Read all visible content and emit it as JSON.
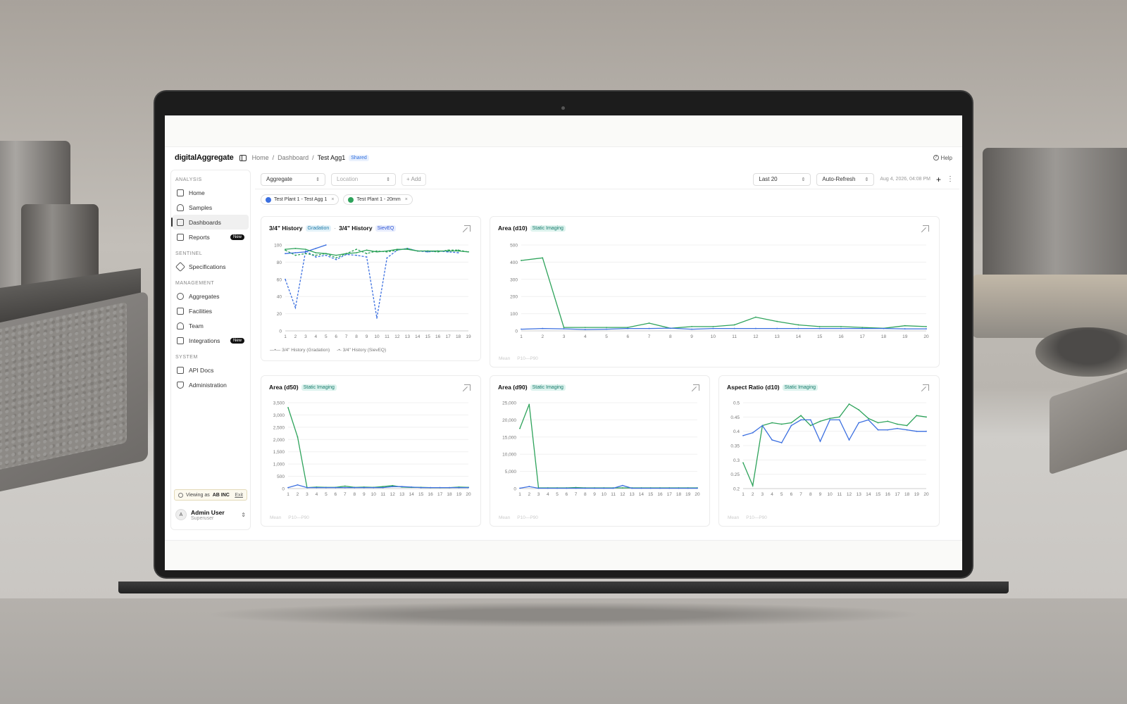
{
  "app": {
    "logo": "digitalAggregate",
    "breadcrumb": [
      "Home",
      "Dashboard",
      "Test Agg1"
    ],
    "shared_badge": "Shared",
    "help": "Help"
  },
  "sidebar": {
    "sections": [
      {
        "label": "ANALYSIS",
        "items": [
          {
            "label": "Home"
          },
          {
            "label": "Samples"
          },
          {
            "label": "Dashboards",
            "active": true
          },
          {
            "label": "Reports",
            "badge": "New"
          }
        ]
      },
      {
        "label": "SENTINEL",
        "items": [
          {
            "label": "Specifications"
          }
        ]
      },
      {
        "label": "MANAGEMENT",
        "items": [
          {
            "label": "Aggregates"
          },
          {
            "label": "Facilities"
          },
          {
            "label": "Team"
          },
          {
            "label": "Integrations",
            "badge": "New"
          }
        ]
      },
      {
        "label": "SYSTEM",
        "items": [
          {
            "label": "API Docs"
          },
          {
            "label": "Administration"
          }
        ]
      }
    ],
    "viewing": {
      "prefix": "Viewing as",
      "org": "AB INC",
      "exit": "Exit"
    },
    "user": {
      "initial": "A",
      "name": "Admin User",
      "role": "Superuser"
    }
  },
  "filters": {
    "aggregate": "Aggregate",
    "location_placeholder": "Location",
    "add": "+ Add",
    "range": "Last 20",
    "refresh": "Auto-Refresh",
    "timestamp": "Aug 4, 2026, 04:08 PM"
  },
  "chips": [
    {
      "label": "Test Plant 1 - Test Agg 1",
      "color": "#3b6fe0"
    },
    {
      "label": "Test Plant 1 - 20mm",
      "color": "#2ea35b"
    }
  ],
  "colors": {
    "blue": "#3b6fe0",
    "green": "#2ea35b"
  },
  "cards": {
    "history": {
      "title1": "3/4\" History",
      "tag1": "Gradation",
      "title2": "3/4\" History",
      "tag2": "SievEQ",
      "legend1": "3/4\" History (Gradation)",
      "legend2": "3/4\" History (SievEQ)"
    },
    "d10": {
      "title": "Area (d10)",
      "tag": "Static Imaging",
      "legend_mean": "Mean",
      "legend_band": "P10—P90"
    },
    "d50": {
      "title": "Area (d50)",
      "tag": "Static Imaging",
      "legend_mean": "Mean",
      "legend_band": "P10—P90"
    },
    "d90": {
      "title": "Area (d90)",
      "tag": "Static Imaging",
      "legend_mean": "Mean",
      "legend_band": "P10—P90"
    },
    "ar": {
      "title": "Aspect Ratio (d10)",
      "tag": "Static Imaging",
      "legend_mean": "Mean",
      "legend_band": "P10—P90"
    }
  },
  "chart_data": [
    {
      "id": "history",
      "type": "line",
      "x": [
        1,
        2,
        3,
        4,
        5,
        6,
        7,
        8,
        9,
        10,
        11,
        12,
        13,
        14,
        15,
        16,
        17,
        18,
        19
      ],
      "ylim": [
        0,
        100
      ],
      "yticks": [
        0,
        20,
        40,
        60,
        80,
        100
      ],
      "series": [
        {
          "name": "3/4\" History (Gradation)",
          "color": "blue",
          "values": [
            90,
            91,
            92,
            96,
            100,
            null,
            null,
            null,
            null,
            null,
            null,
            null,
            null,
            null,
            null,
            null,
            null,
            null,
            null
          ]
        },
        {
          "name": "3/4\" History (SievEQ)",
          "color": "blue",
          "dashed": true,
          "values": [
            60,
            27,
            93,
            86,
            88,
            83,
            89,
            88,
            86,
            15,
            85,
            94,
            96,
            93,
            92,
            93,
            92,
            91,
            null
          ]
        },
        {
          "color": "green",
          "values": [
            95,
            96,
            95,
            91,
            90,
            88,
            90,
            91,
            94,
            92,
            93,
            95,
            95,
            93,
            93,
            93,
            93,
            93,
            92
          ]
        },
        {
          "color": "green",
          "dashed": true,
          "values": [
            94,
            88,
            90,
            88,
            90,
            85,
            90,
            95,
            90,
            93,
            92,
            94,
            96,
            93,
            93,
            92,
            94,
            94,
            92
          ]
        }
      ]
    },
    {
      "id": "d10",
      "type": "line",
      "x": [
        1,
        2,
        3,
        4,
        5,
        6,
        7,
        8,
        9,
        10,
        11,
        12,
        13,
        14,
        15,
        16,
        17,
        18,
        19,
        20
      ],
      "ylim": [
        0,
        500
      ],
      "yticks": [
        0,
        100,
        200,
        300,
        400,
        500
      ],
      "series": [
        {
          "color": "green",
          "values": [
            410,
            425,
            20,
            20,
            20,
            20,
            45,
            15,
            25,
            25,
            35,
            80,
            55,
            35,
            25,
            25,
            20,
            15,
            30,
            25
          ]
        },
        {
          "color": "blue",
          "values": [
            10,
            14,
            12,
            8,
            10,
            14,
            14,
            16,
            10,
            14,
            14,
            14,
            14,
            14,
            14,
            14,
            14,
            14,
            12,
            12
          ]
        }
      ]
    },
    {
      "id": "d50",
      "type": "line",
      "x": [
        1,
        2,
        3,
        4,
        5,
        6,
        7,
        8,
        9,
        10,
        11,
        12,
        13,
        14,
        15,
        16,
        17,
        18,
        19,
        20
      ],
      "ylim": [
        0,
        3500
      ],
      "yticks": [
        0,
        500,
        1000,
        1500,
        2000,
        2500,
        3000,
        3500
      ],
      "series": [
        {
          "color": "green",
          "values": [
            3300,
            2100,
            40,
            60,
            50,
            50,
            100,
            50,
            60,
            50,
            80,
            120,
            60,
            50,
            50,
            40,
            40,
            40,
            60,
            50
          ]
        },
        {
          "color": "blue",
          "values": [
            40,
            150,
            40,
            40,
            40,
            40,
            40,
            40,
            40,
            40,
            40,
            80,
            80,
            60,
            40,
            40,
            40,
            40,
            40,
            40
          ]
        }
      ]
    },
    {
      "id": "d90",
      "type": "line",
      "x": [
        1,
        2,
        3,
        4,
        5,
        6,
        7,
        8,
        9,
        10,
        11,
        12,
        13,
        14,
        15,
        16,
        17,
        18,
        19,
        20
      ],
      "ylim": [
        0,
        25000
      ],
      "yticks": [
        0,
        5000,
        10000,
        15000,
        20000,
        25000
      ],
      "series": [
        {
          "color": "green",
          "values": [
            17500,
            24500,
            200,
            200,
            200,
            200,
            300,
            200,
            200,
            200,
            200,
            200,
            200,
            200,
            200,
            200,
            200,
            200,
            200,
            200
          ]
        },
        {
          "color": "blue",
          "values": [
            100,
            600,
            100,
            100,
            100,
            100,
            100,
            100,
            100,
            100,
            100,
            900,
            100,
            100,
            100,
            100,
            100,
            100,
            100,
            100
          ]
        }
      ]
    },
    {
      "id": "ar",
      "type": "line",
      "x": [
        1,
        2,
        3,
        4,
        5,
        6,
        7,
        8,
        9,
        10,
        11,
        12,
        13,
        14,
        15,
        16,
        17,
        18,
        19,
        20
      ],
      "ylim": [
        0.2,
        0.5
      ],
      "yticks": [
        0.2,
        0.25,
        0.3,
        0.35,
        0.4,
        0.45,
        0.5
      ],
      "series": [
        {
          "color": "green",
          "values": [
            0.29,
            0.21,
            0.42,
            0.43,
            0.425,
            0.43,
            0.455,
            0.42,
            0.435,
            0.445,
            0.45,
            0.495,
            0.475,
            0.445,
            0.43,
            0.435,
            0.425,
            0.42,
            0.455,
            0.45
          ]
        },
        {
          "color": "blue",
          "values": [
            0.385,
            0.395,
            0.42,
            0.37,
            0.36,
            0.42,
            0.44,
            0.44,
            0.365,
            0.44,
            0.44,
            0.37,
            0.43,
            0.44,
            0.405,
            0.405,
            0.41,
            0.405,
            0.4,
            0.4
          ]
        }
      ]
    }
  ]
}
